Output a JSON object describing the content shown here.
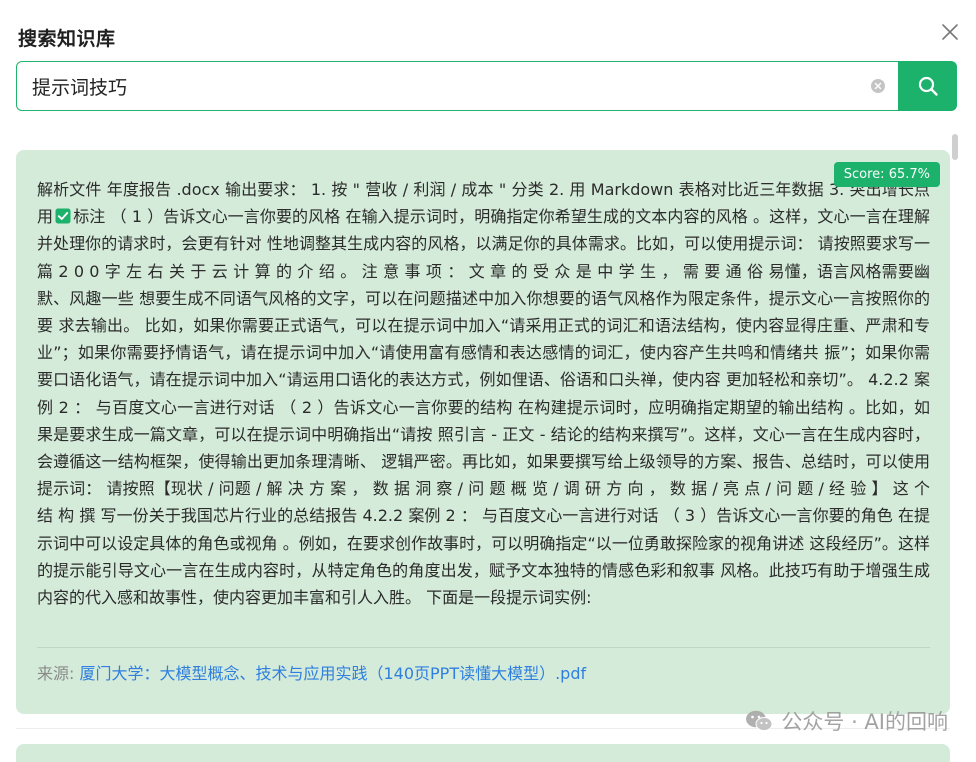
{
  "dialog": {
    "title": "搜索知识库"
  },
  "search": {
    "value": "提示词技巧",
    "placeholder": ""
  },
  "result": {
    "score": "Score: 65.7%",
    "text_before_check": "解析文件 年度报告 .docx 输出要求： 1. 按 \" 营收 / 利润 / 成本 \" 分类 2. 用 Markdown 表格对比近三年数据 3. 突出增长点用",
    "text_after_check": "标注 （ 1 ）告诉文心一言你要的风格 在输入提示词时，明确指定你希望生成的文本内容的风格 。这样，文心一言在理解并处理你的请求时，会更有针对 性地调整其生成内容的风格，以满足你的具体需求。比如，可以使用提示词： 请按照要求写一篇 2 0 0 字 左 右 关 于 云 计 算 的 介 绍 。 注 意 事 项 ： 文 章 的 受 众 是 中 学 生 ， 需 要 通 俗 易懂，语言风格需要幽默、风趣一些 想要生成不同语气风格的文字，可以在问题描述中加入你想要的语气风格作为限定条件，提示文心一言按照你的要 求去输出。 比如，如果你需要正式语气，可以在提示词中加入“请采用正式的词汇和语法结构，使内容显得庄重、严肃和专 业”；如果你需要抒情语气，请在提示词中加入“请使用富有感情和表达感情的词汇，使内容产生共鸣和情绪共 振”；如果你需要口语化语气，请在提示词中加入“请运用口语化的表达方式，例如俚语、俗语和口头禅，使内容 更加轻松和亲切”。 4.2.2 案例 2 ： 与百度文心一言进行对话 （ 2 ）告诉文心一言你要的结构 在构建提示词时，应明确指定期望的输出结构 。比如，如果是要求生成一篇文章，可以在提示词中明确指出“请按 照引言 - 正文 - 结论的结构来撰写”。这样，文心一言在生成内容时，会遵循这一结构框架，使得输出更加条理清晰、 逻辑严密。再比如，如果要撰写给上级领导的方案、报告、总结时，可以使用提示词： 请按照【现状 / 问题 / 解 决 方 案 ， 数 据 洞 察 / 问 题 概 览 / 调 研 方 向 ， 数 据 / 亮 点 / 问 题 / 经 验 】 这 个 结 构 撰 写一份关于我国芯片行业的总结报告 4.2.2 案例 2 ： 与百度文心一言进行对话 （ 3 ）告诉文心一言你要的角色 在提示词中可以设定具体的角色或视角 。例如，在要求创作故事时，可以明确指定“以一位勇敢探险家的视角讲述 这段经历”。这样的提示能引导文心一言在生成内容时，从特定角色的角度出发，赋予文本独特的情感色彩和叙事 风格。此技巧有助于增强生成内容的代入感和故事性，使内容更加丰富和引人入胜。 下面是一段提示词实例:",
    "source_label": "来源: ",
    "source_link": "厦门大学：大模型概念、技术与应用实践（140页PPT读懂大模型）.pdf"
  },
  "watermark": {
    "text": "公众号 · AI的回响"
  },
  "colors": {
    "accent": "#1cb26b",
    "card_bg": "#d4ebd9",
    "link": "#2f7fe0"
  },
  "icons": {
    "close": "close-icon",
    "clear": "clear-circle-icon",
    "search": "search-icon",
    "check": "check-box-icon",
    "wechat": "wechat-icon"
  }
}
